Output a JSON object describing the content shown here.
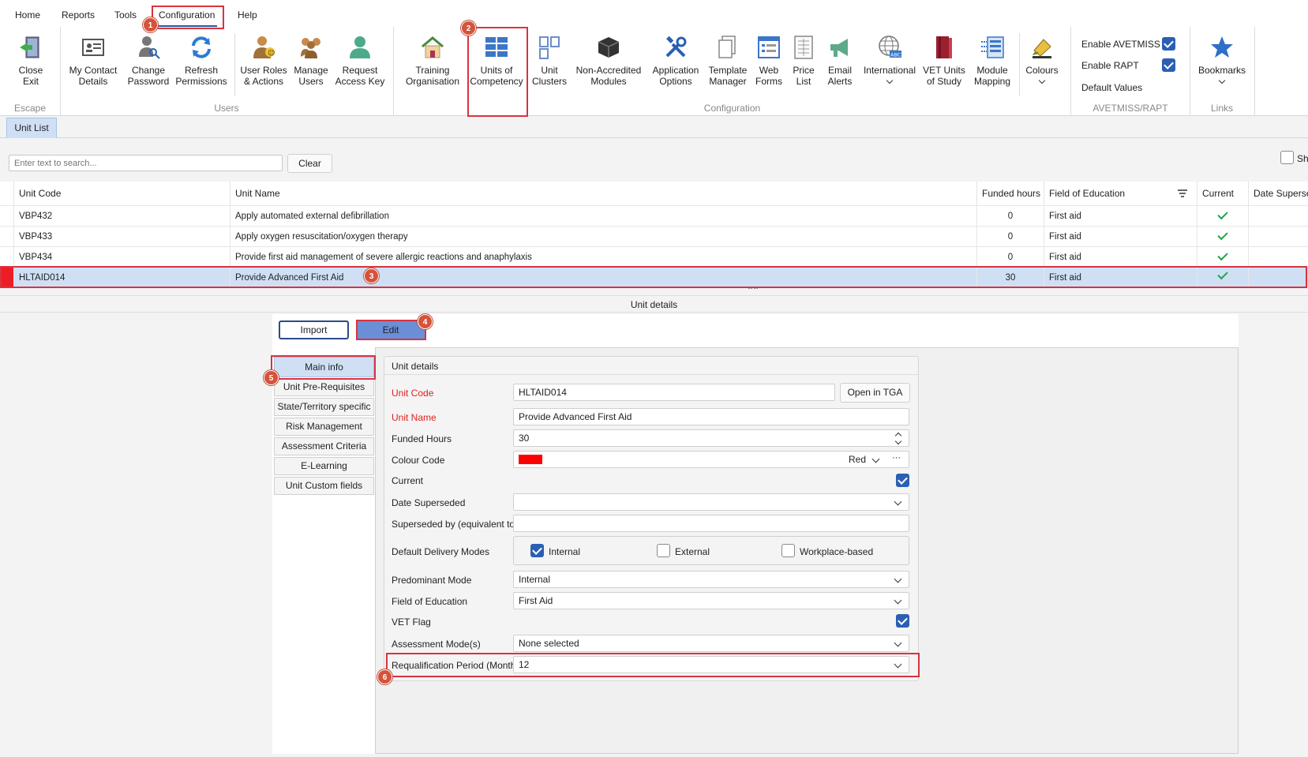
{
  "menu": {
    "items": [
      "Home",
      "Reports",
      "Tools",
      "Configuration",
      "Help"
    ]
  },
  "ribbon": {
    "escape_group": {
      "label": "Escape",
      "buttons": [
        {
          "label": "Close Exit",
          "icon": "exit-door-icon"
        }
      ]
    },
    "users_group": {
      "label": "Users",
      "buttons": [
        {
          "label": "My Contact Details",
          "icon": "contact-card-icon"
        },
        {
          "label": "Change Password",
          "icon": "user-key-icon"
        },
        {
          "label": "Refresh Permissions",
          "icon": "refresh-icon"
        },
        {
          "label": "User Roles & Actions",
          "icon": "user-roles-icon"
        },
        {
          "label": "Manage Users",
          "icon": "users-group-icon"
        },
        {
          "label": "Request Access Key",
          "icon": "user-icon"
        }
      ]
    },
    "configuration_group": {
      "label": "Configuration",
      "buttons": [
        {
          "label": "Training Organisation",
          "icon": "house-icon"
        },
        {
          "label": "Units of Competency",
          "icon": "grid-blocks-icon"
        },
        {
          "label": "Unit Clusters",
          "icon": "clusters-icon"
        },
        {
          "label": "Non-Accredited Modules",
          "icon": "cube-icon"
        },
        {
          "label": "Application Options",
          "icon": "tools-icon"
        },
        {
          "label": "Template Manager",
          "icon": "documents-icon"
        },
        {
          "label": "Web Forms",
          "icon": "web-form-icon"
        },
        {
          "label": "Price List",
          "icon": "price-list-icon"
        },
        {
          "label": "Email Alerts",
          "icon": "megaphone-icon"
        },
        {
          "label": "International",
          "icon": "globe-icon"
        },
        {
          "label": "VET Units of Study",
          "icon": "books-icon"
        },
        {
          "label": "Module Mapping",
          "icon": "module-mapping-icon"
        },
        {
          "label": "Colours",
          "icon": "paint-icon"
        }
      ]
    },
    "avetmiss_group": {
      "label": "AVETMISS/RAPT",
      "items": [
        {
          "label": "Enable AVETMISS",
          "checked": true
        },
        {
          "label": "Enable RAPT",
          "checked": true
        },
        {
          "label": "Default Values"
        }
      ]
    },
    "links_group": {
      "label": "Links",
      "buttons": [
        {
          "label": "Bookmarks",
          "icon": "star-icon"
        }
      ]
    }
  },
  "tab": {
    "label": "Unit List"
  },
  "search": {
    "placeholder": "Enter text to search...",
    "clear_label": "Clear",
    "show_label": "Sh"
  },
  "grid": {
    "columns": [
      "Unit Code",
      "Unit Name",
      "Funded hours",
      "Field of Education",
      "Current",
      "Date Superse"
    ],
    "rows": [
      {
        "code": "VBP432",
        "name": "Apply automated external defibrillation",
        "hours": "0",
        "field": "First aid",
        "current": true
      },
      {
        "code": "VBP433",
        "name": "Apply oxygen resuscitation/oxygen therapy",
        "hours": "0",
        "field": "First aid",
        "current": true
      },
      {
        "code": "VBP434",
        "name": "Provide first aid management of severe allergic reactions and anaphylaxis",
        "hours": "0",
        "field": "First aid",
        "current": true
      },
      {
        "code": "HLTAID014",
        "name": "Provide Advanced First Aid",
        "hours": "30",
        "field": "First aid",
        "current": true
      }
    ]
  },
  "details": {
    "title": "Unit details",
    "import_label": "Import",
    "edit_label": "Edit",
    "side_tabs": [
      "Main info",
      "Unit Pre-Requisites",
      "State/Territory specific",
      "Risk Management",
      "Assessment Criteria",
      "E-Learning",
      "Unit Custom fields"
    ],
    "group_title": "Unit details",
    "fields": {
      "unit_code_label": "Unit Code",
      "unit_code": "HLTAID014",
      "open_tga_label": "Open in TGA",
      "unit_name_label": "Unit Name",
      "unit_name": "Provide Advanced First Aid",
      "funded_hours_label": "Funded Hours",
      "funded_hours": "30",
      "colour_code_label": "Colour Code",
      "colour_code": "Red",
      "colour_swatch": "#ff0000",
      "ellipsis": "···",
      "current_label": "Current",
      "current": true,
      "date_superseded_label": "Date Superseded",
      "date_superseded": "",
      "superseded_by_label": "Superseded by (equivalent to)",
      "superseded_by": "",
      "delivery_modes_label": "Default Delivery Modes",
      "delivery_modes": [
        {
          "label": "Internal",
          "checked": true
        },
        {
          "label": "External",
          "checked": false
        },
        {
          "label": "Workplace-based",
          "checked": false
        }
      ],
      "predominant_mode_label": "Predominant Mode",
      "predominant_mode": "Internal",
      "field_of_education_label": "Field of Education",
      "field_of_education": "First Aid",
      "vet_flag_label": "VET Flag",
      "vet_flag": true,
      "assessment_modes_label": "Assessment Mode(s)",
      "assessment_modes": "None selected",
      "requalification_label": "Requalification Period (Months)",
      "requalification": "12"
    }
  },
  "annotations": [
    "1",
    "2",
    "3",
    "4",
    "5",
    "6"
  ],
  "colors": {
    "accent": "#2b5fb4",
    "highlight_box": "#d9333f",
    "badge": "#d5533b",
    "selected_row": "#cfe0f5"
  }
}
